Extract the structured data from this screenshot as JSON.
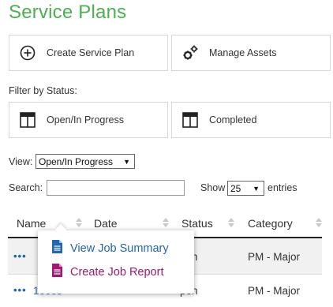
{
  "page": {
    "title": "Service Plans"
  },
  "actions": {
    "create_label": "Create Service Plan",
    "manage_label": "Manage Assets"
  },
  "filter": {
    "label": "Filter by Status:",
    "open_label": "Open/In Progress",
    "completed_label": "Completed"
  },
  "view": {
    "label": "View:",
    "selected": "Open/In Progress"
  },
  "search": {
    "label": "Search:",
    "value": ""
  },
  "paging": {
    "show_label": "Show",
    "selected": "25",
    "entries_label": "entries"
  },
  "table": {
    "headers": [
      "Name",
      "Date",
      "Status",
      "Category"
    ],
    "rows": [
      {
        "menu": "•••",
        "name": "",
        "date": "",
        "status": "pen",
        "category": "PM - Major"
      },
      {
        "menu": "•••",
        "name": "1ooos",
        "date": "",
        "status": "pen",
        "category": "PM - Major"
      }
    ]
  },
  "context_menu": {
    "items": [
      {
        "label": "View Job Summary",
        "color": "#1f66b3"
      },
      {
        "label": "Create Job Report",
        "color": "#a0196e"
      }
    ]
  },
  "colors": {
    "title": "#4caf50",
    "link": "#1f66b3",
    "report": "#a0196e"
  },
  "icons": [
    "plus-circle-icon",
    "gears-icon",
    "layout-icon",
    "doc-icon"
  ]
}
